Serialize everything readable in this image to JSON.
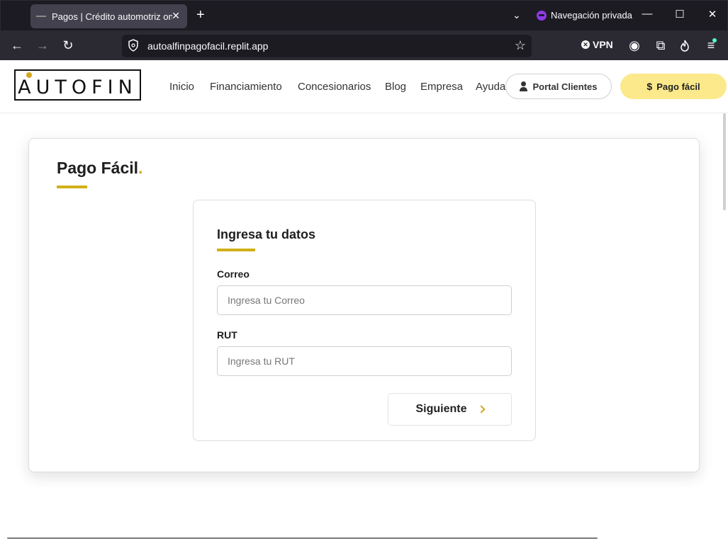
{
  "browser": {
    "tab_title": "Pagos | Crédito automotriz online",
    "tab_close": "✕",
    "new_tab": "+",
    "tabs_list": "⌄",
    "private_label": "Navegación privada",
    "minimize": "—",
    "maximize": "☐",
    "close": "✕",
    "back": "←",
    "forward": "→",
    "reload": "↻",
    "url": "autoalfinpagofacil.replit.app",
    "bookmark": "☆",
    "vpn_label": "VPN",
    "vpn_x": "✕",
    "account": "◉",
    "extensions": "⧉",
    "menu": "≡",
    "private_color": "#8f3ae8"
  },
  "site": {
    "logo_text": "AUTOFIN",
    "menu": [
      "Inicio",
      "Financiamiento",
      "Concesionarios",
      "Blog",
      "Empresa",
      "Ayuda"
    ],
    "portal_button": "Portal Clientes",
    "pago_button": "Pago fácil",
    "pago_symbol": "$",
    "accent_color": "#d1a71d",
    "button_yellow": "#fbe98b"
  },
  "main": {
    "title": "Pago Fácil",
    "title_dot": ".",
    "form": {
      "title": "Ingresa tu datos",
      "email_label": "Correo",
      "email_placeholder": "Ingresa tu Correo",
      "rut_label": "RUT",
      "rut_placeholder": "Ingresa tu RUT",
      "next_button": "Siguiente"
    }
  }
}
